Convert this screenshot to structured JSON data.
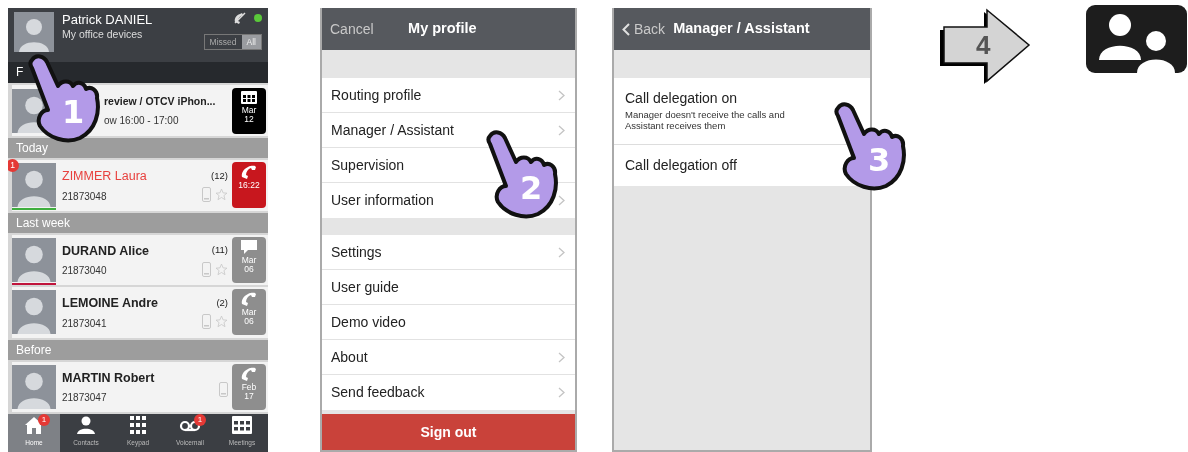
{
  "home_screen": {
    "step": "1",
    "user": {
      "name": "Patrick DANIEL",
      "subtitle": "My office devices",
      "online": true
    },
    "filter": [
      {
        "label": "Missed",
        "selected": false
      },
      {
        "label": "All",
        "selected": true
      }
    ],
    "sections": [
      {
        "title": "F",
        "kind": "favorites",
        "items": [
          {
            "kind": "meeting",
            "title": "review / OTCV iPhon...",
            "subtitle": "ow 16:00 - 17:00",
            "color": "#000000",
            "date": [
              "Mar",
              "12"
            ]
          }
        ]
      },
      {
        "title": "Today",
        "kind": "period",
        "items": [
          {
            "kind": "call",
            "title": "ZIMMER Laura",
            "subtitle": "21873048",
            "missed": true,
            "unread": "1",
            "available": true,
            "count": "(12)",
            "favorite": false,
            "color": "#c8171e",
            "date": [
              "16:22"
            ]
          }
        ]
      },
      {
        "title": "Last week",
        "kind": "period",
        "items": [
          {
            "kind": "message",
            "title": "DURAND Alice",
            "subtitle": "21873040",
            "missed": false,
            "available": false,
            "count": "(11)",
            "favorite": false,
            "color": "#8e8e8e",
            "date": [
              "Mar",
              "06"
            ]
          },
          {
            "kind": "call",
            "title": "LEMOINE Andre",
            "subtitle": "21873041",
            "missed": false,
            "count": "(2)",
            "favorite": false,
            "color": "#8e8e8e",
            "date": [
              "Mar",
              "06"
            ]
          }
        ]
      },
      {
        "title": "Before",
        "kind": "period",
        "items": [
          {
            "kind": "call",
            "title": "MARTIN Robert",
            "subtitle": "21873047",
            "missed": false,
            "color": "#8e8e8e",
            "date": [
              "Feb",
              "17"
            ]
          }
        ]
      }
    ],
    "tabs": [
      {
        "label": "Home",
        "kind": "home",
        "selected": true,
        "badge": "1"
      },
      {
        "label": "Contacts",
        "kind": "contacts",
        "selected": false
      },
      {
        "label": "Keypad",
        "kind": "keypad",
        "selected": false
      },
      {
        "label": "Voicemail",
        "kind": "voicemail",
        "selected": false,
        "badge": "1"
      },
      {
        "label": "Meetings",
        "kind": "meetings",
        "selected": false
      }
    ]
  },
  "profile_screen": {
    "step": "2",
    "cancel": "Cancel",
    "title": "My profile",
    "groups": [
      [
        {
          "label": "Routing profile",
          "chevron": true
        },
        {
          "label": "Manager / Assistant",
          "chevron": true
        },
        {
          "label": "Supervision",
          "chevron": false
        },
        {
          "label": "User information",
          "chevron": true
        }
      ],
      [
        {
          "label": "Settings",
          "chevron": true
        },
        {
          "label": "User guide",
          "chevron": false
        },
        {
          "label": "Demo video",
          "chevron": false
        },
        {
          "label": "About",
          "chevron": true
        },
        {
          "label": "Send feedback",
          "chevron": true
        }
      ]
    ],
    "sign_out": "Sign out"
  },
  "delegation_screen": {
    "step": "3",
    "back": "Back",
    "title": "Manager / Assistant",
    "options": [
      {
        "label": "Call delegation on",
        "description": "Manager doesn't receive the calls and Assistant receives them"
      },
      {
        "label": "Call delegation off"
      }
    ]
  },
  "next_step": {
    "step": "4"
  }
}
